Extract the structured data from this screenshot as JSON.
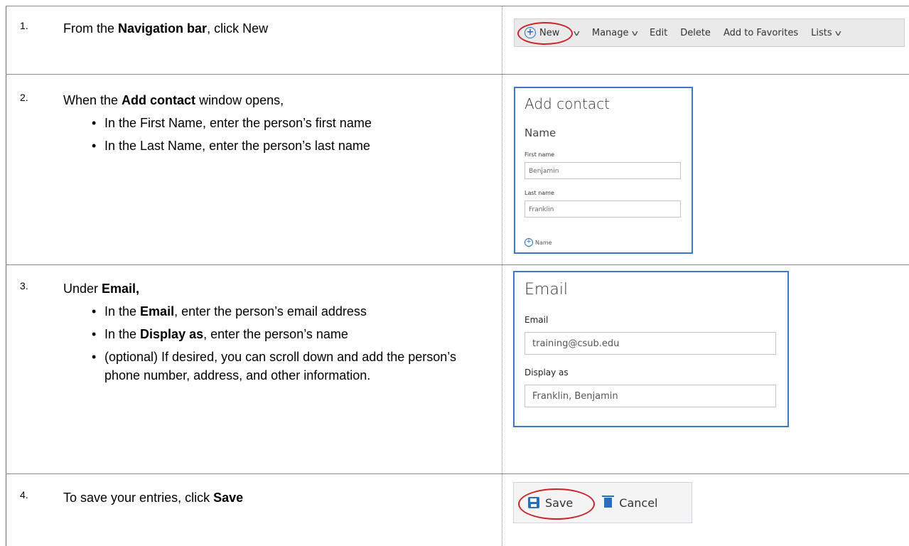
{
  "steps": [
    {
      "number": "1.",
      "text_pre": "From the ",
      "text_bold": "Navigation bar",
      "text_post": ", click New"
    },
    {
      "number": "2.",
      "text_pre": "When the ",
      "text_bold": "Add contact",
      "text_post": " window opens,",
      "bullets": [
        "In the First Name, enter the person’s first name",
        "In the Last Name, enter the person’s last name"
      ]
    },
    {
      "number": "3.",
      "text_pre": "Under ",
      "text_bold": "Email,",
      "bullets": [
        {
          "pre": "In the ",
          "bold": "Email",
          "post": ", enter the person’s email address"
        },
        {
          "pre": "In the ",
          "bold": "Display as",
          "post": ", enter the person’s name"
        },
        {
          "pre": "",
          "bold": "",
          "post": "(optional) If desired, you can scroll down and add the person’s phone number, address, and other information."
        }
      ]
    },
    {
      "number": "4.",
      "text_pre": "To save your entries, click ",
      "text_bold": "Save"
    }
  ],
  "navbar": {
    "new": "New",
    "manage": "Manage",
    "edit": "Edit",
    "delete": "Delete",
    "add_to_favorites": "Add to Favorites",
    "lists": "Lists"
  },
  "add_contact": {
    "title": "Add contact",
    "section": "Name",
    "first_name_label": "First name",
    "first_name_value": "Benjamin",
    "last_name_label": "Last name",
    "last_name_value": "Franklin",
    "add_name_link": "Name"
  },
  "email_panel": {
    "title": "Email",
    "email_label": "Email",
    "email_value": "training@csub.edu",
    "display_label": "Display as",
    "display_value": "Franklin, Benjamin"
  },
  "savebar": {
    "save": "Save",
    "cancel": "Cancel"
  },
  "colors": {
    "accent": "#2a6ebb",
    "highlight_ring": "#c8252c",
    "panel_border": "#3f7ac0"
  }
}
